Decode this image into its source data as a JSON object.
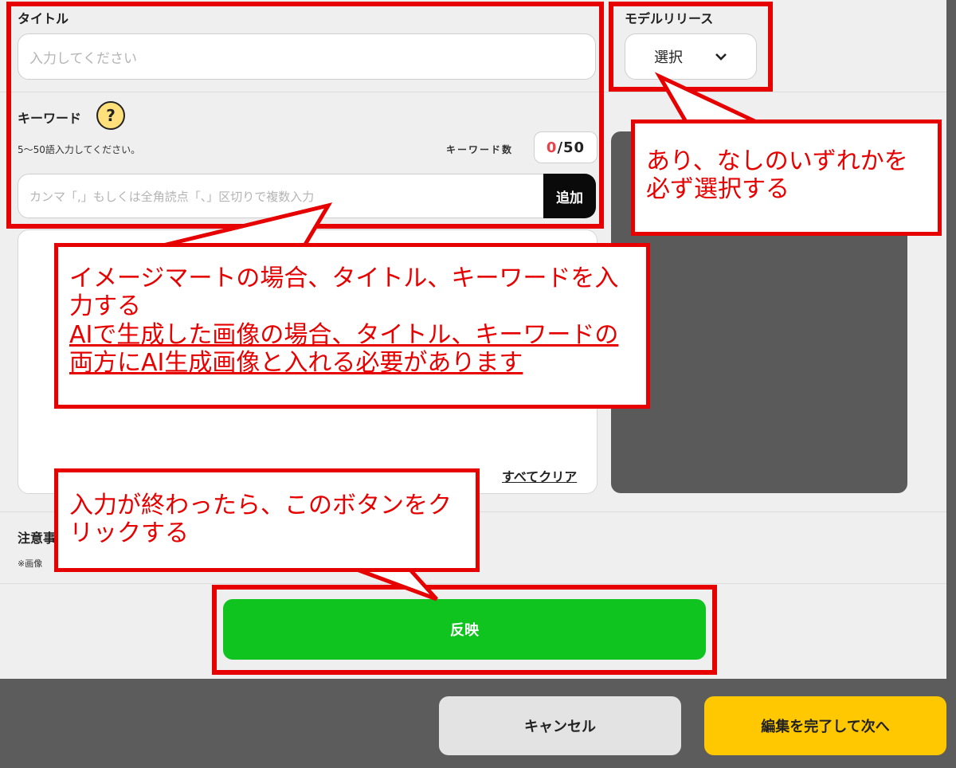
{
  "title_field": {
    "label": "タイトル",
    "placeholder": "入力してください"
  },
  "model_release": {
    "label": "モデルリリース",
    "selected": "選択"
  },
  "keyword_field": {
    "label": "キーワード",
    "help": "?",
    "hint": "5〜50語入力してください。",
    "count_label": "キーワード数",
    "count_current": "0",
    "count_max": "/50",
    "placeholder": "カンマ「,」もしくは全角読点「、」区切りで複数入力",
    "add_label": "追加"
  },
  "keyword_list": {
    "clear_all": "すべてクリア"
  },
  "notice": {
    "label_partial": "注意事",
    "text_partial": "※画像"
  },
  "actions": {
    "reflect": "反映",
    "cancel": "キャンセル",
    "finish_next": "編集を完了して次へ"
  },
  "annotations": {
    "callout_model": "あり、なしのいずれかを必ず選択する",
    "callout_keywords_line1": "イメージマートの場合、タイトル、キーワードを入力する",
    "callout_keywords_line2": "AIで生成した画像の場合、タイトル、キーワードの両方にAI生成画像と入れる必要があります",
    "callout_button": "入力が終わったら、このボタンをクリックする"
  },
  "colors": {
    "annotation_red": "#e60000",
    "reflect_green": "#10c41f",
    "next_yellow": "#ffc800",
    "counter_red": "#e8424a"
  }
}
